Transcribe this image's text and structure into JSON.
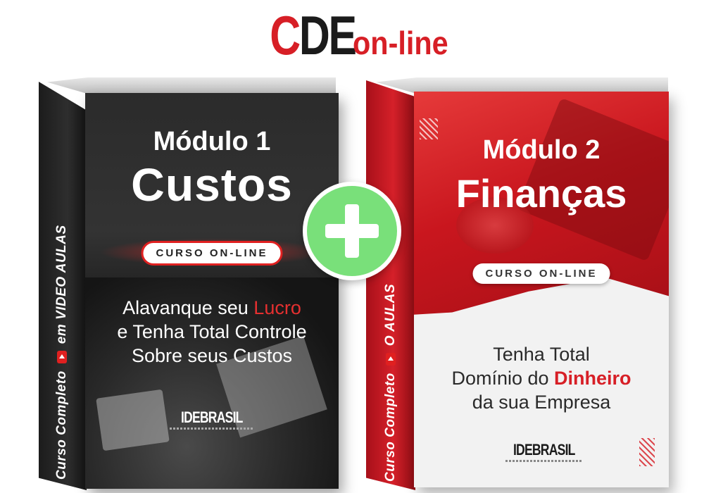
{
  "header": {
    "logo_c": "C",
    "logo_de": "DE",
    "logo_online": "on-line"
  },
  "products": [
    {
      "spine_left": "Curso Completo",
      "spine_right": "em VIDEO AULAS",
      "module_label": "Módulo 1",
      "module_name": "Custos",
      "badge": "CURSO ON-LINE",
      "tagline_line1_prefix": "Alavanque seu ",
      "tagline_line1_highlight": "Lucro",
      "tagline_line2": "e Tenha Total Controle",
      "tagline_line3": "Sobre seus Custos",
      "brand": "IDEBRASIL"
    },
    {
      "spine_left": "Curso Completo",
      "spine_right": "O AULAS",
      "module_label": "Módulo 2",
      "module_name": "Finanças",
      "badge": "CURSO ON-LINE",
      "tagline_line1": "Tenha Total",
      "tagline_line2_prefix": "Domínio do ",
      "tagline_line2_highlight": "Dinheiro",
      "tagline_line3": "da sua Empresa",
      "brand": "IDEBRASIL"
    }
  ],
  "colors": {
    "brand_red": "#d71f26",
    "dark": "#1b1b1b",
    "plus_green": "#79e07a"
  },
  "icons": {
    "plus": "plus-icon",
    "play": "play-icon"
  }
}
